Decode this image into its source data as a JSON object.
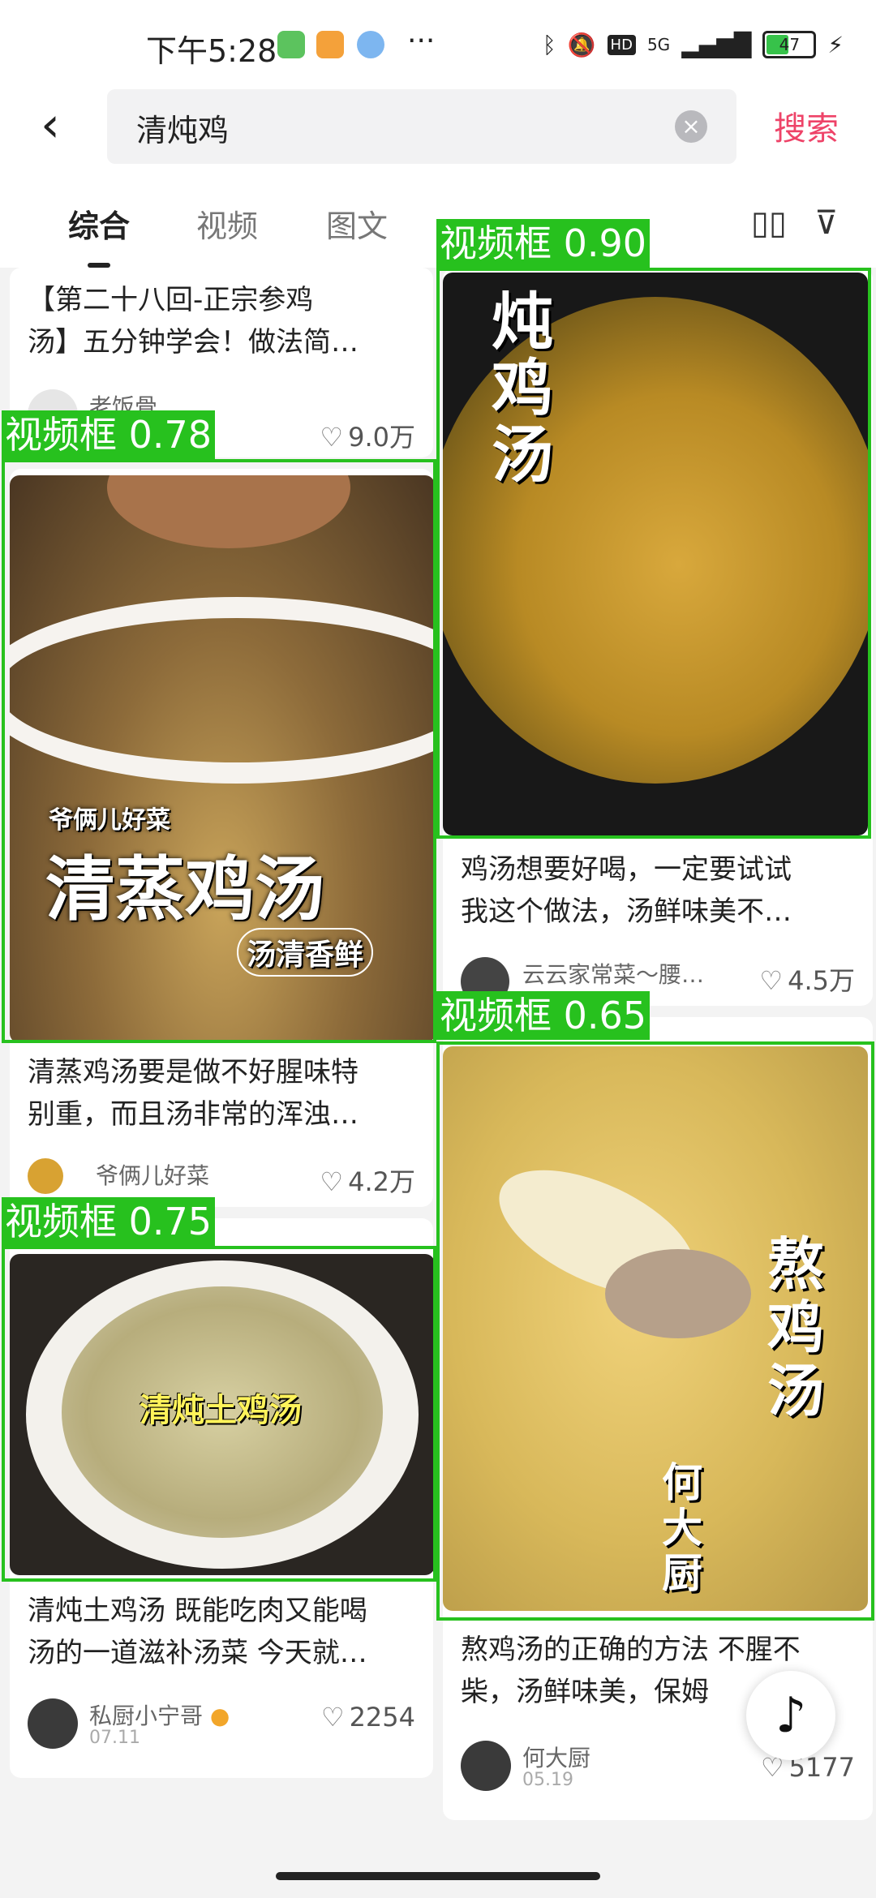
{
  "status": {
    "time": "下午5:28",
    "network": "5G",
    "battery": "47"
  },
  "search": {
    "query": "清炖鸡",
    "button": "搜索"
  },
  "tabs": [
    "综合",
    "视频",
    "图文"
  ],
  "detections": [
    {
      "label": "视频框 0.90"
    },
    {
      "label": "视频框 0.78"
    },
    {
      "label": "视频框 0.65"
    },
    {
      "label": "视频框 0.75"
    }
  ],
  "cards": [
    {
      "title_line1": "【第二十八回-正宗参鸡",
      "title_line2": "汤】五分钟学会！做法简…",
      "author": "老饭骨",
      "likes": "9.0万"
    },
    {
      "overlay_top": "爷俩儿好菜",
      "overlay_main": "清蒸鸡汤",
      "overlay_sub": "汤清香鲜",
      "title_line1": "清蒸鸡汤要是做不好腥味特",
      "title_line2": "别重，而且汤非常的浑浊…",
      "author": "爷俩儿好菜",
      "likes": "4.2万"
    },
    {
      "overlay": "清炖土鸡汤",
      "title_line1": "清炖土鸡汤 既能吃肉又能喝",
      "title_line2": "汤的一道滋补汤菜 今天就…",
      "author": "私厨小宁哥",
      "date": "07.11",
      "likes": "2254"
    },
    {
      "overlay": "炖鸡汤",
      "title_line1": "鸡汤想要好喝，一定要试试",
      "title_line2": "我这个做法，汤鲜味美不…",
      "author": "云云家常菜～腰…",
      "likes": "4.5万"
    },
    {
      "overlay": "熬鸡汤",
      "overlay_sub": "何大厨",
      "title_line1": "熬鸡汤的正确的方法 不腥不",
      "title_line2": "柴，汤鲜味美，保姆",
      "author": "何大厨",
      "date": "05.19",
      "likes": "5177"
    }
  ]
}
